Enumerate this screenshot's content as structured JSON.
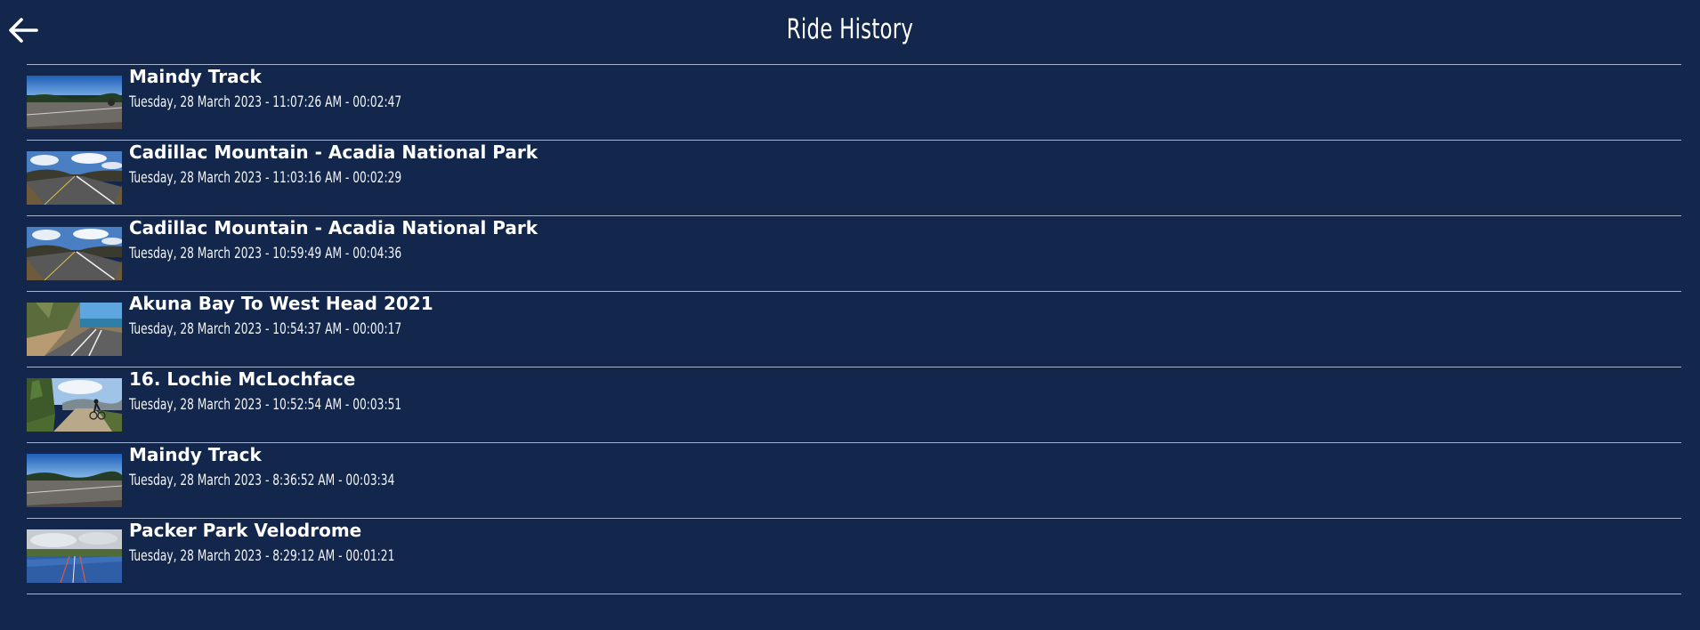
{
  "header": {
    "title": "Ride History",
    "back_icon": "arrow-left-icon"
  },
  "colors": {
    "background": "#13264b",
    "divider": "#a9b3c7",
    "text": "#ffffff"
  },
  "rides": [
    {
      "name": "Maindy Track",
      "meta": "Tuesday, 28 March 2023 - 11:07:26 AM - 00:02:47",
      "thumb": "track-road"
    },
    {
      "name": "Cadillac Mountain - Acadia National Park",
      "meta": "Tuesday, 28 March 2023 - 11:03:16 AM - 00:02:29",
      "thumb": "mountain-road"
    },
    {
      "name": "Cadillac Mountain - Acadia National Park",
      "meta": "Tuesday, 28 March 2023 - 10:59:49 AM - 00:04:36",
      "thumb": "mountain-road"
    },
    {
      "name": "Akuna Bay To West Head 2021",
      "meta": "Tuesday, 28 March 2023 - 10:54:37 AM - 00:00:17",
      "thumb": "coastal-road"
    },
    {
      "name": "16. Lochie McLochface",
      "meta": "Tuesday, 28 March 2023 - 10:52:54 AM - 00:03:51",
      "thumb": "cyclist-trail"
    },
    {
      "name": "Maindy Track",
      "meta": "Tuesday, 28 March 2023 - 8:36:52 AM - 00:03:34",
      "thumb": "track-road"
    },
    {
      "name": "Packer Park Velodrome",
      "meta": "Tuesday, 28 March 2023 - 8:29:12 AM - 00:01:21",
      "thumb": "velodrome"
    }
  ]
}
